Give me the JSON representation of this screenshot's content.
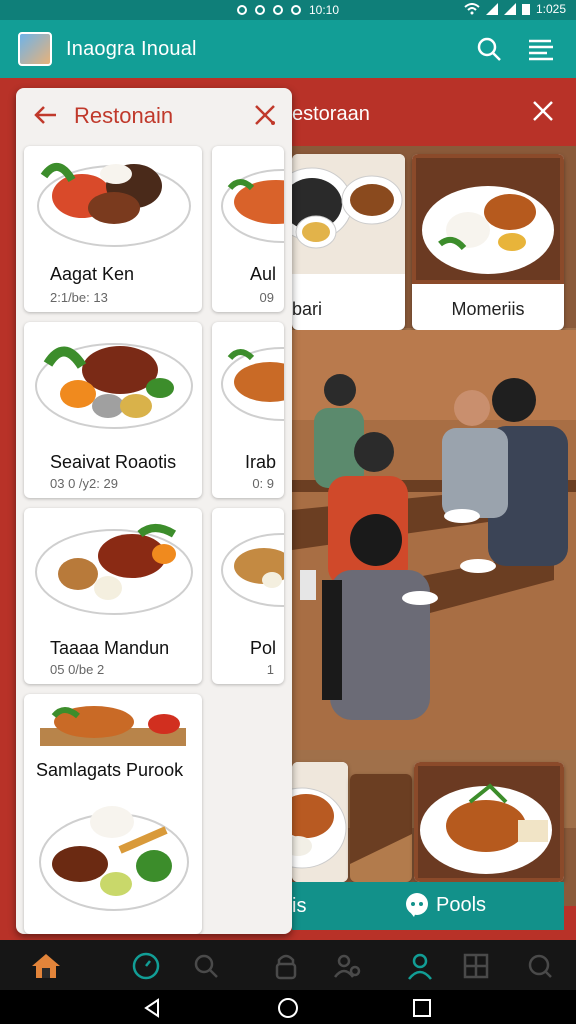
{
  "status_bar": {
    "center_text": "10:10",
    "time": "1:025"
  },
  "app_bar": {
    "title": "Inaogra Inoual"
  },
  "panel": {
    "title": "Restonain",
    "cards": [
      {
        "name": "Aagat Ken",
        "meta": "2:1/be: 13"
      },
      {
        "name": "Seaivat Roaotis",
        "meta": "03 0 /y2: 29"
      },
      {
        "name": "Taaaa Mandun",
        "meta": "05 0/be 2"
      },
      {
        "name": "Samlagats Purook",
        "meta": ""
      }
    ],
    "side_cards": [
      {
        "name": "Aul",
        "meta": "09"
      },
      {
        "name": "Irab",
        "meta": "0: 9"
      },
      {
        "name": "Pol",
        "meta": "1"
      }
    ]
  },
  "back_modal": {
    "title": "estoraan",
    "cards": [
      {
        "label": "bari"
      },
      {
        "label": "Momeriis"
      }
    ],
    "bottom_left": "is",
    "pools": "Pools"
  },
  "colors": {
    "teal": "#129e96",
    "accent_red": "#c0392b",
    "bg_red": "#b83228"
  }
}
